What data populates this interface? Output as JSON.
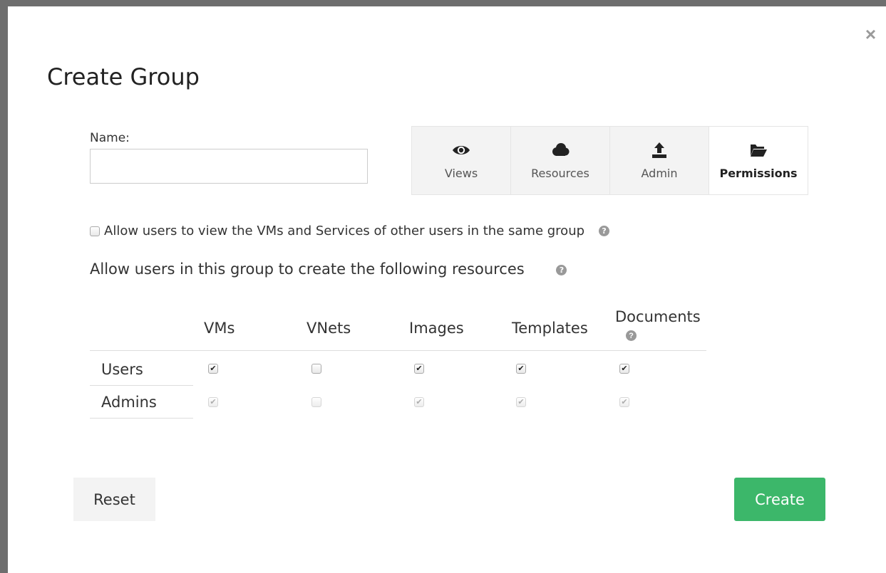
{
  "dialog": {
    "title": "Create Group",
    "close_symbol": "×"
  },
  "name_field": {
    "label": "Name:",
    "value": "",
    "placeholder": ""
  },
  "tabs": [
    {
      "label": "Views",
      "icon": "eye-icon",
      "active": false
    },
    {
      "label": "Resources",
      "icon": "cloud-icon",
      "active": false
    },
    {
      "label": "Admin",
      "icon": "upload-icon",
      "active": false
    },
    {
      "label": "Permissions",
      "icon": "folder-open-icon",
      "active": true
    }
  ],
  "shared_view": {
    "label": "Allow users to view the VMs and Services of other users in the same group",
    "checked": false
  },
  "resources": {
    "heading": "Allow users in this group to create the following resources",
    "columns": [
      "VMs",
      "VNets",
      "Images",
      "Templates",
      "Documents"
    ],
    "rows": [
      {
        "label": "Users",
        "values": [
          true,
          false,
          true,
          true,
          true
        ],
        "disabled": false
      },
      {
        "label": "Admins",
        "values": [
          true,
          false,
          true,
          true,
          true
        ],
        "disabled": true
      }
    ]
  },
  "buttons": {
    "reset": "Reset",
    "create": "Create"
  },
  "colors": {
    "create_button": "#3cb76a",
    "tab_background": "#f3f3f3"
  }
}
